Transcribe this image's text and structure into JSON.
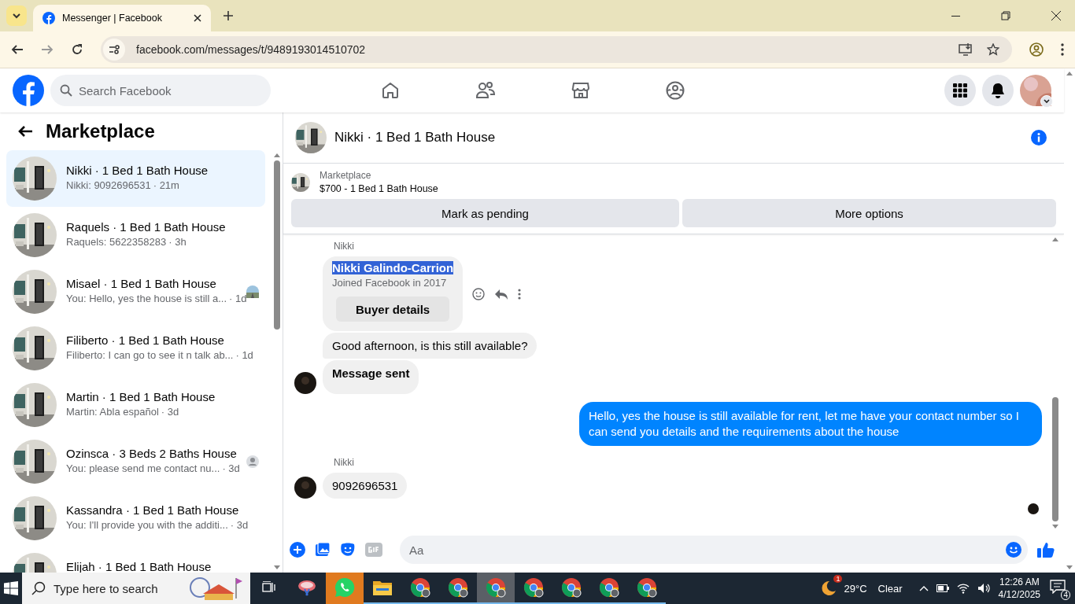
{
  "browser": {
    "tab_title": "Messenger | Facebook",
    "url": "facebook.com/messages/t/9489193014510702"
  },
  "header": {
    "search_placeholder": "Search Facebook"
  },
  "sidebar": {
    "title": "Marketplace",
    "conversations": [
      {
        "title": "Nikki · 1 Bed 1 Bath House",
        "preview": "Nikki: 9092696531",
        "time": "· 21m",
        "selected": true
      },
      {
        "title": "Raquels · 1 Bed 1 Bath House",
        "preview": "Raquels: 5622358283",
        "time": "· 3h",
        "selected": false
      },
      {
        "title": "Misael · 1 Bed 1 Bath House",
        "preview": "You: Hello, yes the house is still a...",
        "time": "· 1d",
        "selected": false
      },
      {
        "title": "Filiberto · 1 Bed 1 Bath House",
        "preview": "Filiberto: I can go to see it n talk ab...",
        "time": "· 1d",
        "selected": false
      },
      {
        "title": "Martin · 1 Bed 1 Bath House",
        "preview": "Martin: Abla español",
        "time": "· 3d",
        "selected": false
      },
      {
        "title": "Ozinsca · 3 Beds 2 Baths House",
        "preview": "You: please send me contact nu...",
        "time": "· 3d",
        "selected": false,
        "seen": {
          "kind": "default"
        }
      },
      {
        "title": "Kassandra · 1 Bed 1 Bath House",
        "preview": "You: I'll provide you with the additi...",
        "time": "· 3d",
        "selected": false
      },
      {
        "title": "Elijah · 1 Bed 1 Bath House",
        "selected": false
      }
    ]
  },
  "chat": {
    "title": "Nikki · 1 Bed 1 Bath House",
    "listing": {
      "label": "Marketplace",
      "title": "$700 - 1 Bed 1 Bath House"
    },
    "buttons": [
      "Mark as pending",
      "More options"
    ],
    "messages": [
      {
        "kind": "name",
        "text": "Nikki"
      },
      {
        "kind": "card",
        "name": "Nikki Galindo-Carrion",
        "highlighted": true,
        "subtitle": "Joined Facebook in 2017",
        "button": "Buyer details"
      },
      {
        "kind": "incoming",
        "text": "Good afternoon, is this still available?",
        "bold": false,
        "avatar": false
      },
      {
        "kind": "incoming",
        "text": "Message sent",
        "bold": true,
        "avatar": true
      },
      {
        "kind": "outgoing",
        "text": "Hello, yes the house is still available for rent, let me have your contact number so I can send you details and the requirements about the house"
      },
      {
        "kind": "name",
        "text": "Nikki"
      },
      {
        "kind": "incoming",
        "text": "9092696531",
        "bold": false,
        "avatar": true
      }
    ],
    "composer_placeholder": "Aa"
  },
  "taskbar": {
    "search_placeholder": "Type here to search",
    "apps": [
      {
        "kind": "taskview",
        "selected": false
      },
      {
        "kind": "snip",
        "selected": false
      },
      {
        "kind": "whatsapp",
        "selected": true
      },
      {
        "kind": "explorer",
        "selected": false
      },
      {
        "kind": "chrome",
        "selected": false
      },
      {
        "kind": "chrome",
        "selected": false
      },
      {
        "kind": "chrome",
        "selected": true
      },
      {
        "kind": "chrome",
        "selected": false
      },
      {
        "kind": "chrome",
        "selected": false
      },
      {
        "kind": "chrome",
        "selected": false
      },
      {
        "kind": "chrome",
        "selected": false
      }
    ],
    "weather_badge": "1",
    "temperature": "29°C",
    "condition": "Clear",
    "time": "12:26 AM",
    "date": "4/12/2025",
    "notifications": "4"
  }
}
